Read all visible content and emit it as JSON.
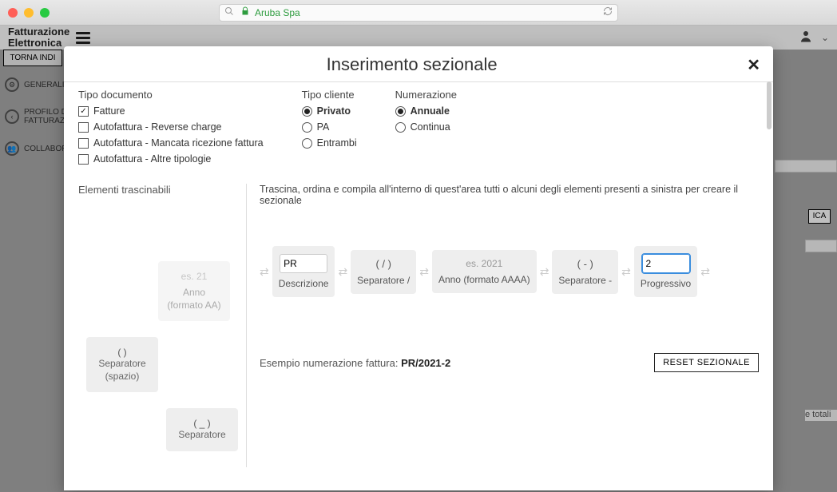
{
  "browser": {
    "url_label": "Aruba Spa"
  },
  "app": {
    "logo_line1": "Fatturazione",
    "logo_line2": "Elettronica",
    "back_btn": "TORNA INDI",
    "side1": "GENERALI",
    "side2a": "PROFILO DI",
    "side2b": "FATTURAZIC",
    "side3": "COLLABORA",
    "frag_ica": "ICA",
    "frag_totali": "e totali"
  },
  "modal": {
    "title": "Inserimento sezionale",
    "tipo_documento_h": "Tipo documento",
    "doc_opts": {
      "fatture": "Fatture",
      "reverse": "Autofattura - Reverse charge",
      "mancata": "Autofattura - Mancata ricezione fattura",
      "altre": "Autofattura - Altre tipologie"
    },
    "tipo_cliente_h": "Tipo cliente",
    "cliente_opts": {
      "privato": "Privato",
      "pa": "PA",
      "entrambi": "Entrambi"
    },
    "numerazione_h": "Numerazione",
    "num_opts": {
      "annuale": "Annuale",
      "continua": "Continua"
    },
    "left_h": "Elementi trascinabili",
    "drag_src1_ex": "es. 21",
    "drag_src1_nm": "Anno\n(formato AA)",
    "drag_src2_sym": "( )",
    "drag_src2_nm": "Separatore (spazio)",
    "drag_src3_sym": "( _ )",
    "drag_src3_nm": "Separatore",
    "instr": "Trascina, ordina e compila all'interno di quest'area tutti o alcuni degli elementi presenti a sinistra per creare il sezionale",
    "seq": {
      "desc_input": "PR",
      "desc_lbl": "Descrizione",
      "sep1_sym": "( / )",
      "sep1_lbl": "Separatore /",
      "anno_ex": "es. 2021",
      "anno_lbl": "Anno (formato AAAA)",
      "sep2_sym": "( - )",
      "sep2_lbl": "Separatore -",
      "prog_input": "2",
      "prog_lbl": "Progressivo"
    },
    "example_label": "Esempio numerazione fattura:",
    "example_value": "PR/2021-2",
    "reset_btn": "RESET SEZIONALE"
  }
}
